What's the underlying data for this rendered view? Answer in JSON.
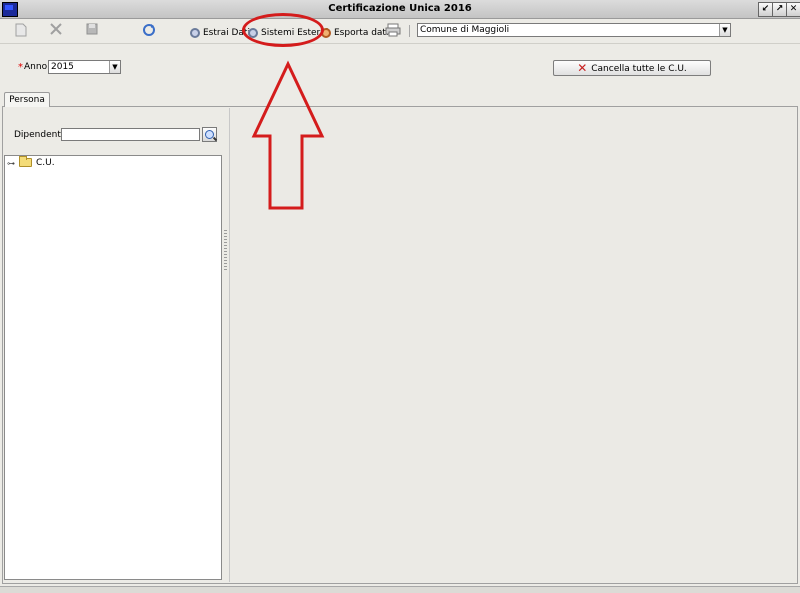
{
  "window": {
    "title": "Certificazione Unica 2016",
    "buttons": [
      "↙",
      "↗",
      "✕"
    ]
  },
  "toolbar": {
    "new_icon": "new-document-icon",
    "delete_icon": "delete-icon",
    "save_icon": "save-icon",
    "refresh_icon": "refresh-icon",
    "estrai_label": "Estrai Dati",
    "sistemi_label": "Sistemi Esterni",
    "esporta_label": "Esporta dati",
    "print_icon": "printer-icon",
    "ente_value": "Comune di Maggioli"
  },
  "form": {
    "required_mark": "*",
    "anno_label": "Anno",
    "anno_value": "2015",
    "cancel_all_label": "Cancella tutte le C.U."
  },
  "tabs": [
    "Persona"
  ],
  "persona": {
    "dipendente_label": "Dipendente",
    "dipendente_value": "",
    "tree_root": "C.U."
  },
  "annotation": {
    "color": "#d41c1c"
  }
}
